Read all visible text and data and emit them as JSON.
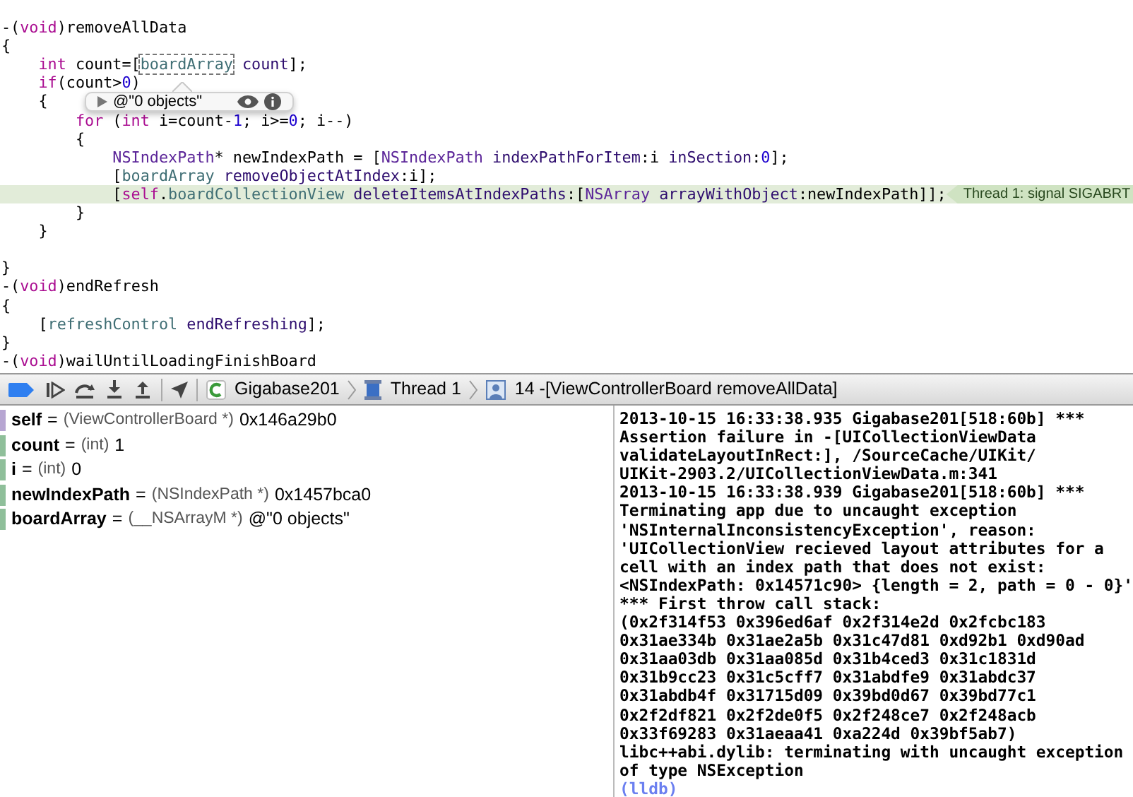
{
  "editor": {
    "lines": [
      {
        "kind": "blank"
      },
      {
        "kind": "code",
        "tokens": [
          {
            "kind": "plain",
            "text": "-("
          },
          {
            "kind": "keyword",
            "text": "void"
          },
          {
            "kind": "plain",
            "text": ")removeAllData"
          }
        ]
      },
      {
        "kind": "code",
        "tokens": [
          {
            "kind": "plain",
            "text": "{"
          }
        ],
        "children": [
          {
            "kind": "code",
            "tokens": [
              {
                "kind": "keyword",
                "text": "int"
              },
              {
                "kind": "plain",
                "text": " count=["
              },
              {
                "kind": "hovered",
                "text": "boardArray"
              },
              {
                "kind": "method",
                "text": " count"
              },
              {
                "kind": "plain",
                "text": "];"
              }
            ]
          },
          {
            "kind": "code",
            "tokens": [
              {
                "kind": "keyword",
                "text": "if"
              },
              {
                "kind": "plain",
                "text": "(count>"
              },
              {
                "kind": "number",
                "text": "0"
              },
              {
                "kind": "plain",
                "text": ")"
              }
            ]
          },
          {
            "kind": "code",
            "tokens": [
              {
                "kind": "plain",
                "text": "{"
              }
            ],
            "children": [
              {
                "kind": "code",
                "tokens": [
                  {
                    "kind": "keyword",
                    "text": "for"
                  },
                  {
                    "kind": "plain",
                    "text": " ("
                  },
                  {
                    "kind": "keyword",
                    "text": "int"
                  },
                  {
                    "kind": "plain",
                    "text": " i=count-"
                  },
                  {
                    "kind": "number",
                    "text": "1"
                  },
                  {
                    "kind": "plain",
                    "text": "; i>="
                  },
                  {
                    "kind": "number",
                    "text": "0"
                  },
                  {
                    "kind": "plain",
                    "text": "; i--)"
                  }
                ]
              },
              {
                "kind": "code",
                "tokens": [
                  {
                    "kind": "plain",
                    "text": "{"
                  }
                ],
                "children": [
                  {
                    "kind": "code",
                    "tokens": [
                      {
                        "kind": "class",
                        "text": "NSIndexPath"
                      },
                      {
                        "kind": "plain",
                        "text": "* newIndexPath = ["
                      },
                      {
                        "kind": "class",
                        "text": "NSIndexPath"
                      },
                      {
                        "kind": "method",
                        "text": " indexPathForItem"
                      },
                      {
                        "kind": "plain",
                        "text": ":i "
                      },
                      {
                        "kind": "method",
                        "text": "inSection"
                      },
                      {
                        "kind": "plain",
                        "text": ":"
                      },
                      {
                        "kind": "number",
                        "text": "0"
                      },
                      {
                        "kind": "plain",
                        "text": "];"
                      }
                    ]
                  },
                  {
                    "kind": "code",
                    "tokens": [
                      {
                        "kind": "plain",
                        "text": "["
                      },
                      {
                        "kind": "ivar",
                        "text": "boardArray"
                      },
                      {
                        "kind": "method",
                        "text": " removeObjectAtIndex"
                      },
                      {
                        "kind": "plain",
                        "text": ":i];"
                      }
                    ]
                  },
                  {
                    "kind": "code",
                    "highlighted": true,
                    "badge": "Thread 1: signal SIGABRT",
                    "tokens": [
                      {
                        "kind": "plain",
                        "text": "["
                      },
                      {
                        "kind": "keyword",
                        "text": "self"
                      },
                      {
                        "kind": "plain",
                        "text": "."
                      },
                      {
                        "kind": "ivar",
                        "text": "boardCollectionView"
                      },
                      {
                        "kind": "method",
                        "text": " deleteItemsAtIndexPaths"
                      },
                      {
                        "kind": "plain",
                        "text": ":["
                      },
                      {
                        "kind": "class",
                        "text": "NSArray"
                      },
                      {
                        "kind": "method",
                        "text": " arrayWithObject"
                      },
                      {
                        "kind": "plain",
                        "text": ":newIndexPath]];"
                      }
                    ]
                  }
                ]
              },
              {
                "kind": "code",
                "tokens": [
                  {
                    "kind": "plain",
                    "text": "}"
                  }
                ]
              }
            ]
          },
          {
            "kind": "code",
            "tokens": [
              {
                "kind": "plain",
                "text": "}"
              }
            ]
          }
        ]
      },
      {
        "kind": "blank"
      },
      {
        "kind": "code",
        "tokens": [
          {
            "kind": "plain",
            "text": "}"
          }
        ]
      },
      {
        "kind": "code",
        "tokens": [
          {
            "kind": "plain",
            "text": "-("
          },
          {
            "kind": "keyword",
            "text": "void"
          },
          {
            "kind": "plain",
            "text": ")endRefresh"
          }
        ]
      },
      {
        "kind": "code",
        "tokens": [
          {
            "kind": "plain",
            "text": "{"
          }
        ],
        "children": [
          {
            "kind": "code",
            "tokens": [
              {
                "kind": "plain",
                "text": "["
              },
              {
                "kind": "ivar",
                "text": "refreshControl"
              },
              {
                "kind": "method",
                "text": " endRefreshing"
              },
              {
                "kind": "plain",
                "text": "];"
              }
            ]
          }
        ]
      },
      {
        "kind": "code",
        "tokens": [
          {
            "kind": "plain",
            "text": "}"
          }
        ]
      },
      {
        "kind": "code",
        "tokens": [
          {
            "kind": "plain",
            "text": "-("
          },
          {
            "kind": "keyword",
            "text": "void"
          },
          {
            "kind": "plain",
            "text": ")wailUntilLoadingFinishBoard"
          }
        ]
      }
    ],
    "popover": {
      "value": "@\"0 objects\""
    }
  },
  "debug_bar": {
    "breakpoints_on": true,
    "path": [
      {
        "kind": "app",
        "label": "Gigabase201"
      },
      {
        "kind": "thread",
        "label": "Thread 1"
      },
      {
        "kind": "frame",
        "label": "14 -[ViewControllerBoard removeAllData]"
      }
    ]
  },
  "variables": [
    {
      "kind": "argument",
      "name": "self",
      "equals": "=",
      "type": "(ViewControllerBoard *)",
      "value": "0x146a29b0"
    },
    {
      "kind": "local",
      "name": "count",
      "equals": "=",
      "type": "(int)",
      "value": "1"
    },
    {
      "kind": "local",
      "name": "i",
      "equals": "=",
      "type": "(int)",
      "value": "0"
    },
    {
      "kind": "local",
      "name": "newIndexPath",
      "equals": "=",
      "type": "(NSIndexPath *)",
      "value": "0x1457bca0"
    },
    {
      "kind": "local",
      "name": "boardArray",
      "equals": "=",
      "type": "(__NSArrayM *)",
      "value": "@\"0 objects\""
    }
  ],
  "console": [
    {
      "kind": "output",
      "text": "2013-10-15 16:33:38.935 Gigabase201[518:60b] ***"
    },
    {
      "kind": "output",
      "text": "Assertion failure in -[UICollectionViewData"
    },
    {
      "kind": "output",
      "text": "validateLayoutInRect:], /SourceCache/UIKit/"
    },
    {
      "kind": "output",
      "text": "UIKit-2903.2/UICollectionViewData.m:341"
    },
    {
      "kind": "output",
      "text": "2013-10-15 16:33:38.939 Gigabase201[518:60b] ***"
    },
    {
      "kind": "output",
      "text": "Terminating app due to uncaught exception"
    },
    {
      "kind": "output",
      "text": "'NSInternalInconsistencyException', reason:"
    },
    {
      "kind": "output",
      "text": "'UICollectionView recieved layout attributes for a"
    },
    {
      "kind": "output",
      "text": "cell with an index path that does not exist:"
    },
    {
      "kind": "output",
      "text": "<NSIndexPath: 0x14571c90> {length = 2, path = 0 - 0}'"
    },
    {
      "kind": "output",
      "text": "*** First throw call stack:"
    },
    {
      "kind": "output",
      "text": "(0x2f314f53 0x396ed6af 0x2f314e2d 0x2fcbc183"
    },
    {
      "kind": "output",
      "text": "0x31ae334b 0x31ae2a5b 0x31c47d81 0xd92b1 0xd90ad"
    },
    {
      "kind": "output",
      "text": "0x31aa03db 0x31aa085d 0x31b4ced3 0x31c1831d"
    },
    {
      "kind": "output",
      "text": "0x31b9cc23 0x31c5cff7 0x31abdfe9 0x31abdc37"
    },
    {
      "kind": "output",
      "text": "0x31abdb4f 0x31715d09 0x39bd0d67 0x39bd77c1"
    },
    {
      "kind": "output",
      "text": "0x2f2df821 0x2f2de0f5 0x2f248ce7 0x2f248acb"
    },
    {
      "kind": "output",
      "text": "0x33f69283 0x31aeaa41 0xa224d 0x39bf5ab7)"
    },
    {
      "kind": "output",
      "text": "libc++abi.dylib: terminating with uncaught exception"
    },
    {
      "kind": "output",
      "text": "of type NSException"
    },
    {
      "kind": "prompt",
      "text": "(lldb)"
    }
  ]
}
